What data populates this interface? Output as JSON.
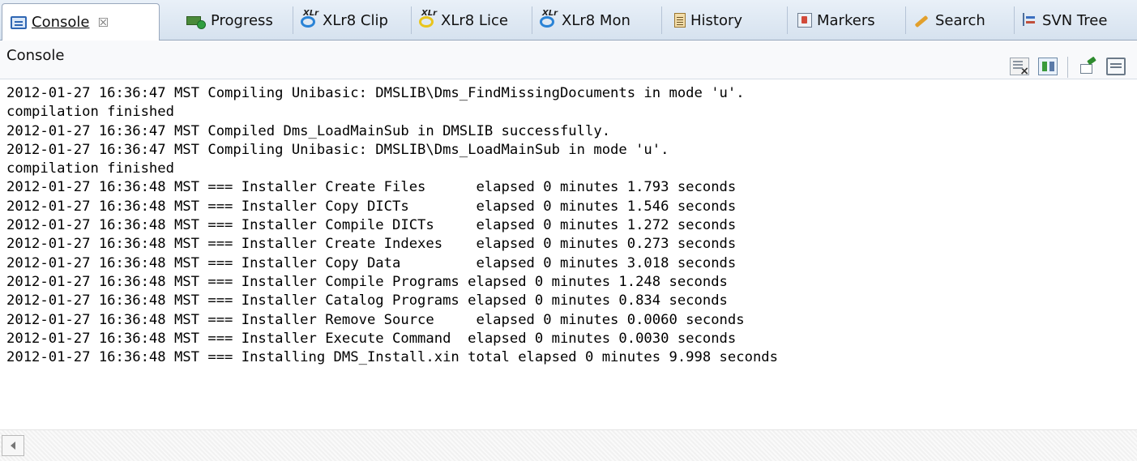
{
  "tabs": [
    {
      "label": "Console",
      "icon": "console-icon",
      "active": true,
      "close": "☒"
    },
    {
      "label": "Progress",
      "icon": "progress-icon"
    },
    {
      "label": "XLr8 Clip",
      "icon": "xlr8-icon"
    },
    {
      "label": "XLr8 Lice",
      "icon": "xlr8-icon"
    },
    {
      "label": "XLr8 Mon",
      "icon": "xlr8-icon"
    },
    {
      "label": "History",
      "icon": "history-icon"
    },
    {
      "label": "Markers",
      "icon": "markers-icon"
    },
    {
      "label": "Search",
      "icon": "search-icon"
    },
    {
      "label": "SVN Tree",
      "icon": "svn-tree-icon"
    }
  ],
  "view": {
    "title": "Console"
  },
  "console": {
    "lines": [
      "2012-01-27 16:36:47 MST Compiling Unibasic: DMSLIB\\Dms_FindMissingDocuments in mode 'u'.",
      "compilation finished",
      "2012-01-27 16:36:47 MST Compiled Dms_LoadMainSub in DMSLIB successfully.",
      "2012-01-27 16:36:47 MST Compiling Unibasic: DMSLIB\\Dms_LoadMainSub in mode 'u'.",
      "compilation finished",
      "2012-01-27 16:36:48 MST === Installer Create Files      elapsed 0 minutes 1.793 seconds",
      "2012-01-27 16:36:48 MST === Installer Copy DICTs        elapsed 0 minutes 1.546 seconds",
      "2012-01-27 16:36:48 MST === Installer Compile DICTs     elapsed 0 minutes 1.272 seconds",
      "2012-01-27 16:36:48 MST === Installer Create Indexes    elapsed 0 minutes 0.273 seconds",
      "2012-01-27 16:36:48 MST === Installer Copy Data         elapsed 0 minutes 3.018 seconds",
      "2012-01-27 16:36:48 MST === Installer Compile Programs elapsed 0 minutes 1.248 seconds",
      "2012-01-27 16:36:48 MST === Installer Catalog Programs elapsed 0 minutes 0.834 seconds",
      "2012-01-27 16:36:48 MST === Installer Remove Source     elapsed 0 minutes 0.0060 seconds",
      "2012-01-27 16:36:48 MST === Installer Execute Command  elapsed 0 minutes 0.0030 seconds",
      "2012-01-27 16:36:48 MST === Installing DMS_Install.xin total elapsed 0 minutes 9.998 seconds"
    ]
  }
}
